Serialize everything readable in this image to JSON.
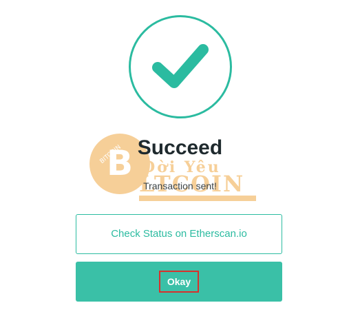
{
  "result": {
    "icon": "checkmark-icon",
    "title": "Succeed",
    "message": "Transaction sent!"
  },
  "actions": {
    "status_label": "Check Status on Etherscan.io",
    "okay_label": "Okay"
  },
  "watermark": {
    "coin_text": "BITCOIN",
    "brand_text": "BLTCOIN",
    "brand_top": "Đời Yêu"
  },
  "colors": {
    "accent": "#2bbba0",
    "button_fill": "#3ac0a7",
    "highlight": "#d9302c",
    "watermark": "#f0a945"
  }
}
